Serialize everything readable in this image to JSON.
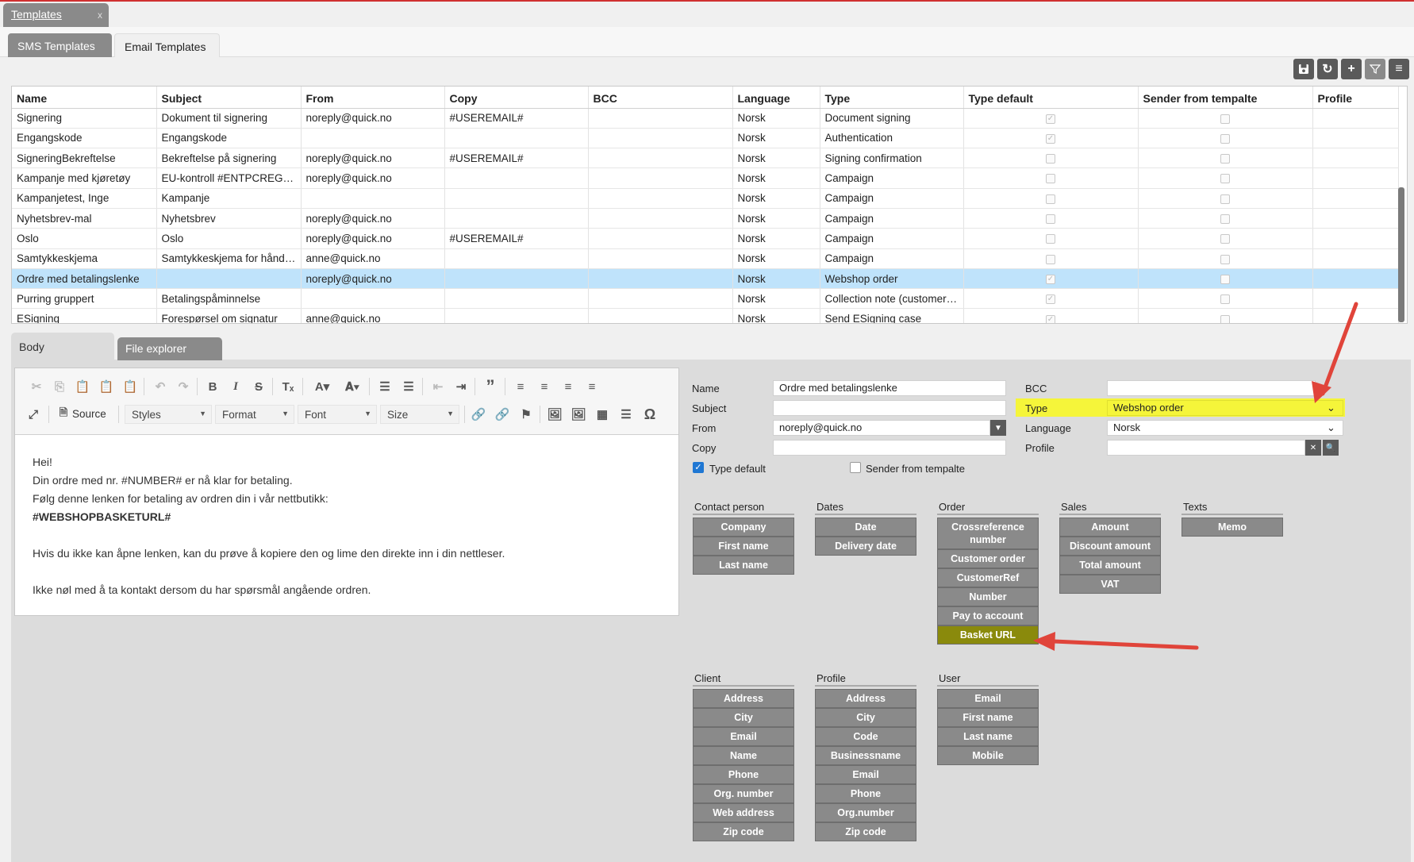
{
  "top_tab": {
    "label": "Templates",
    "close": "x"
  },
  "sub_tabs": [
    "SMS Templates",
    "Email Templates"
  ],
  "grid": {
    "columns": [
      "Name",
      "Subject",
      "From",
      "Copy",
      "BCC",
      "Language",
      "Type",
      "Type default",
      "Sender from tempalte",
      "Profile"
    ],
    "rows": [
      {
        "name": "Signering",
        "subject": "Dokument til signering",
        "from": "noreply@quick.no",
        "copy": "#USEREMAIL#",
        "bcc": "",
        "language": "Norsk",
        "type": "Document signing",
        "type_default": true,
        "sender": false,
        "profile": ""
      },
      {
        "name": "Engangskode",
        "subject": "Engangskode",
        "from": "",
        "copy": "",
        "bcc": "",
        "language": "Norsk",
        "type": "Authentication",
        "type_default": true,
        "sender": false,
        "profile": ""
      },
      {
        "name": "SigneringBekreftelse",
        "subject": "Bekreftelse på signering",
        "from": "noreply@quick.no",
        "copy": "#USEREMAIL#",
        "bcc": "",
        "language": "Norsk",
        "type": "Signing confirmation",
        "type_default": false,
        "sender": false,
        "profile": ""
      },
      {
        "name": "Kampanje med kjøretøy",
        "subject": "EU-kontroll #ENTPCREGNR#",
        "from": "noreply@quick.no",
        "copy": "",
        "bcc": "",
        "language": "Norsk",
        "type": "Campaign",
        "type_default": false,
        "sender": false,
        "profile": ""
      },
      {
        "name": "Kampanjetest, Inge",
        "subject": "Kampanje",
        "from": "",
        "copy": "",
        "bcc": "",
        "language": "Norsk",
        "type": "Campaign",
        "type_default": false,
        "sender": false,
        "profile": ""
      },
      {
        "name": "Nyhetsbrev-mal",
        "subject": "Nyhetsbrev",
        "from": "noreply@quick.no",
        "copy": "",
        "bcc": "",
        "language": "Norsk",
        "type": "Campaign",
        "type_default": false,
        "sender": false,
        "profile": ""
      },
      {
        "name": "Oslo",
        "subject": "Oslo",
        "from": "noreply@quick.no",
        "copy": "#USEREMAIL#",
        "bcc": "",
        "language": "Norsk",
        "type": "Campaign",
        "type_default": false,
        "sender": false,
        "profile": ""
      },
      {
        "name": "Samtykkeskjema",
        "subject": "Samtykkeskjema for håndt…",
        "from": "anne@quick.no",
        "copy": "",
        "bcc": "",
        "language": "Norsk",
        "type": "Campaign",
        "type_default": false,
        "sender": false,
        "profile": ""
      },
      {
        "name": "Ordre med betalingslenke",
        "subject": "",
        "from": "noreply@quick.no",
        "copy": "",
        "bcc": "",
        "language": "Norsk",
        "type": "Webshop order",
        "type_default": true,
        "sender": false,
        "profile": "",
        "selected": true
      },
      {
        "name": "Purring gruppert",
        "subject": "Betalingspåminnelse",
        "from": "",
        "copy": "",
        "bcc": "",
        "language": "Norsk",
        "type": "Collection note (customer …",
        "type_default": true,
        "sender": false,
        "profile": ""
      },
      {
        "name": "ESigning",
        "subject": "Forespørsel om signatur",
        "from": "anne@quick.no",
        "copy": "",
        "bcc": "",
        "language": "Norsk",
        "type": "Send ESigning case",
        "type_default": true,
        "sender": false,
        "profile": ""
      }
    ]
  },
  "lower_tabs": {
    "body": "Body",
    "files": "File explorer"
  },
  "editor_toolbar": {
    "source": "Source",
    "styles": "Styles",
    "format": "Format",
    "font": "Font",
    "size": "Size"
  },
  "editor_content": [
    {
      "text": "Hei!",
      "bold": false
    },
    {
      "text": "Din ordre med nr. #NUMBER# er nå klar for betaling.",
      "bold": false
    },
    {
      "text": "Følg denne lenken for betaling av ordren din i vår nettbutikk:",
      "bold": false
    },
    {
      "text": "#WEBSHOPBASKETURL#",
      "bold": true
    },
    {
      "text": "",
      "bold": false
    },
    {
      "text": "Hvis du ikke kan åpne lenken, kan du prøve å kopiere den og lime den direkte inn i din nettleser.",
      "bold": false
    },
    {
      "text": "",
      "bold": false
    },
    {
      "text": "Ikke nøl med å ta kontakt dersom du har spørsmål angående ordren.",
      "bold": false
    }
  ],
  "form": {
    "name_label": "Name",
    "name_value": "Ordre med betalingslenke",
    "subject_label": "Subject",
    "subject_value": "",
    "from_label": "From",
    "from_value": "noreply@quick.no",
    "copy_label": "Copy",
    "copy_value": "",
    "bcc_label": "BCC",
    "bcc_value": "",
    "type_label": "Type",
    "type_value": "Webshop order",
    "language_label": "Language",
    "language_value": "Norsk",
    "profile_label": "Profile",
    "profile_value": "",
    "type_default_label": "Type default",
    "type_default_checked": true,
    "sender_label": "Sender from tempalte",
    "sender_checked": false
  },
  "merge_groups": {
    "contact": {
      "title": "Contact person",
      "items": [
        "Company",
        "First name",
        "Last name"
      ]
    },
    "dates": {
      "title": "Dates",
      "items": [
        "Date",
        "Delivery date"
      ]
    },
    "order": {
      "title": "Order",
      "items": [
        "Crossreference number",
        "Customer order",
        "CustomerRef",
        "Number",
        "Pay to account",
        "Basket URL"
      ]
    },
    "sales": {
      "title": "Sales",
      "items": [
        "Amount",
        "Discount amount",
        "Total amount",
        "VAT"
      ]
    },
    "texts": {
      "title": "Texts",
      "items": [
        "Memo"
      ]
    },
    "client": {
      "title": "Client",
      "items": [
        "Address",
        "City",
        "Email",
        "Name",
        "Phone",
        "Org. number",
        "Web address",
        "Zip code"
      ]
    },
    "profile": {
      "title": "Profile",
      "items": [
        "Address",
        "City",
        "Code",
        "Businessname",
        "Email",
        "Phone",
        "Org.number",
        "Zip code"
      ]
    },
    "user": {
      "title": "User",
      "items": [
        "Email",
        "First name",
        "Last name",
        "Mobile"
      ]
    }
  },
  "highlights": {
    "type_field": "#f5f53a",
    "basket_url": "#8a8a0c",
    "arrow": "#e0443a",
    "selected_row": "#bfe3fb",
    "checkbox_on": "#1f77d3"
  },
  "icons": [
    "save-icon",
    "refresh-icon",
    "add-icon",
    "filter-icon",
    "menu-icon"
  ]
}
